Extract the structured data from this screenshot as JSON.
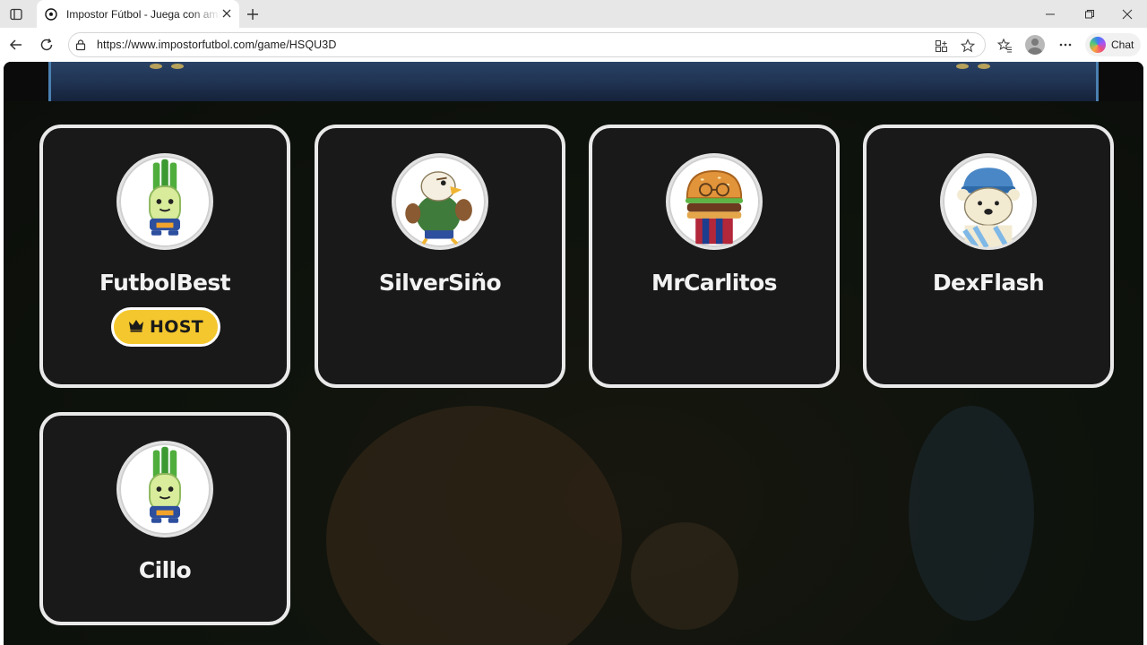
{
  "browser": {
    "tab_title": "Impostor Fútbol - Juega con amigos",
    "url": "https://www.impostorfutbol.com/game/HSQU3D",
    "chat_label": "Chat"
  },
  "players": [
    {
      "name": "FutbolBest",
      "avatar": "leek-player-avatar",
      "is_host": true,
      "badge_label": "HOST"
    },
    {
      "name": "SilverSiño",
      "avatar": "eagle-avatar",
      "is_host": false
    },
    {
      "name": "MrCarlitos",
      "avatar": "burger-avatar",
      "is_host": false
    },
    {
      "name": "DexFlash",
      "avatar": "polar-bear-avatar",
      "is_host": false
    },
    {
      "name": "Cillo",
      "avatar": "leek-player-avatar",
      "is_host": false
    }
  ],
  "colors": {
    "card_background": "#191919",
    "card_border": "#e9e9e9",
    "host_badge": "#f4c72e"
  }
}
